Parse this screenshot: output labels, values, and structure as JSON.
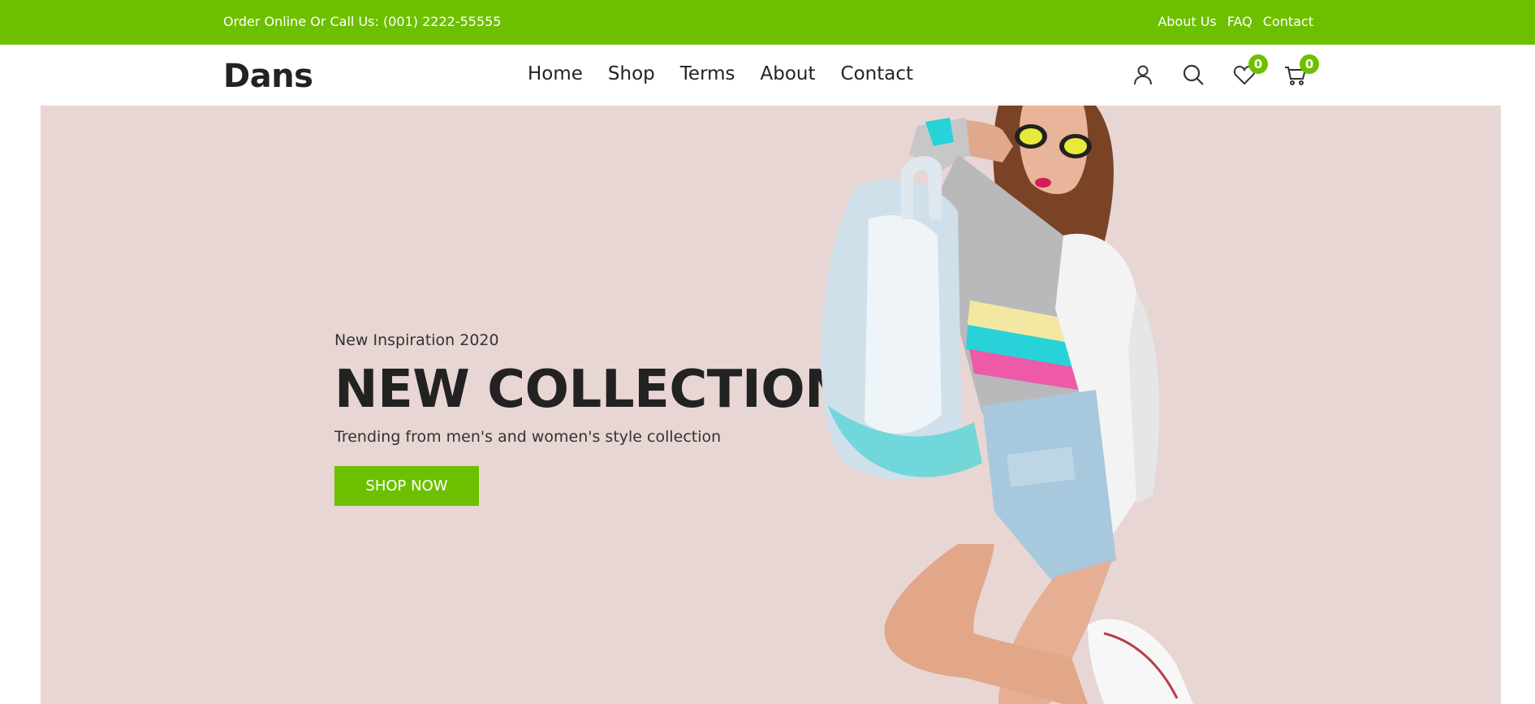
{
  "topbar": {
    "phone_text": "Order Online Or Call Us: (001) 2222-55555",
    "links": [
      "About Us",
      "FAQ",
      "Contact"
    ]
  },
  "header": {
    "logo": "Dans",
    "nav": [
      "Home",
      "Shop",
      "Terms",
      "About",
      "Contact"
    ],
    "icons": {
      "account": "user-icon",
      "search": "search-icon",
      "wishlist": "heart-icon",
      "cart": "cart-icon"
    },
    "wishlist_count": "0",
    "cart_count": "0"
  },
  "hero": {
    "subtitle": "New Inspiration 2020",
    "headline": "NEW COLLECTION!",
    "tagline": "Trending from men's and women's style collection",
    "button_label": "SHOP NOW",
    "image": "fashion-model-with-holographic-backpack"
  },
  "colors": {
    "accent": "#6cc000",
    "hero_background": "#e7d6d3",
    "text_dark": "#222222"
  }
}
